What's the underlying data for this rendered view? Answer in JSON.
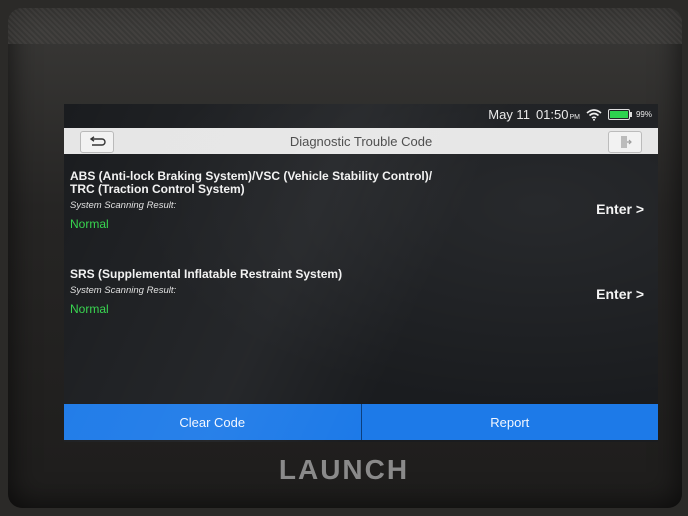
{
  "status": {
    "date": "May 11",
    "time": "01:50",
    "ampm": "PM",
    "battery_pct": "99%",
    "battery_level": 0.99
  },
  "titlebar": {
    "title": "Diagnostic Trouble Code"
  },
  "systems": [
    {
      "name_line1": "ABS (Anti-lock Braking System)/VSC (Vehicle Stability Control)/",
      "name_line2": "TRC (Traction Control System)",
      "result_label": "System Scanning Result:",
      "result": "Normal",
      "enter_label": "Enter >"
    },
    {
      "name_line1": "SRS (Supplemental Inflatable Restraint System)",
      "result_label": "System Scanning Result:",
      "result": "Normal",
      "enter_label": "Enter >"
    }
  ],
  "actions": {
    "clear_code": "Clear Code",
    "report": "Report"
  },
  "brand": "LAUNCH",
  "colors": {
    "accent_blue": "#1d7ae8",
    "normal_green": "#35d44d",
    "titlebar_bg": "#e6e6e6"
  }
}
